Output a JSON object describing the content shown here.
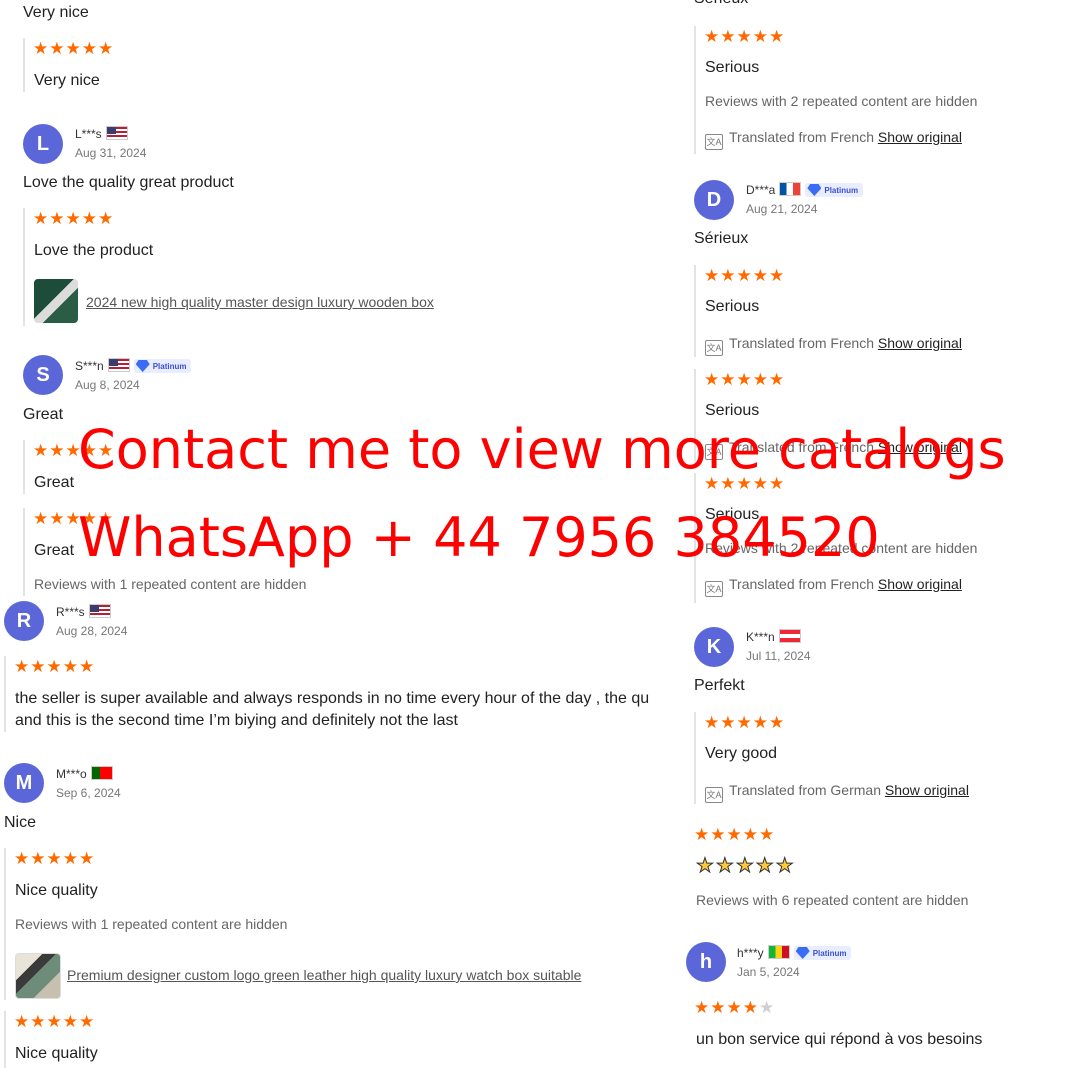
{
  "colors": {
    "star": "#ff6a00",
    "avatar": "#5b67d8",
    "overlay": "#ff0000"
  },
  "left": {
    "r0": {
      "title": "Very nice",
      "follow_text": "Very nice"
    },
    "r1": {
      "avatar": "L",
      "name": "L***s",
      "flag": "us",
      "date": "Aug 31, 2024",
      "title": "Love the quality great product",
      "follow_text": "Love the product",
      "product": "2024 new high quality master design                luxury wooden box"
    },
    "r2": {
      "avatar": "S",
      "name": "S***n",
      "flag": "us",
      "badge": "Platinum",
      "date": "Aug 8, 2024",
      "title": "Great",
      "follow1": "Great",
      "follow2": "Great",
      "hidden": "Reviews with 1 repeated content are hidden"
    },
    "r3": {
      "avatar": "R",
      "name": "R***s",
      "flag": "us",
      "date": "Aug 28, 2024",
      "line1": "the seller is super available and always responds in no time every hour of the day , the qu",
      "line2": "and this is the second time I’m biying and definitely not the last"
    },
    "r4": {
      "avatar": "M",
      "name": "M***o",
      "flag": "pt",
      "date": "Sep 6, 2024",
      "title": "Nice",
      "follow_text": "Nice quality",
      "hidden": "Reviews with 1 repeated content are hidden",
      "product": "Premium designer custom logo green leather high quality luxury watch box suitable",
      "follow2": "Nice quality"
    }
  },
  "right": {
    "top_title": "Sérieux",
    "r0": {
      "follow_text": "Serious",
      "hidden": "Reviews with 2 repeated content are hidden",
      "translated": "Translated from French",
      "show_original": "Show original"
    },
    "r1": {
      "avatar": "D",
      "name": "D***a",
      "flag": "fr",
      "badge": "Platinum",
      "date": "Aug 21, 2024",
      "title": "Sérieux",
      "f1": "Serious",
      "f1_trans": "Translated from French",
      "f1_show": "Show original",
      "f2": "Serious",
      "f2_trans": "Translated from French",
      "f2_show": "Show original",
      "f3": "Serious",
      "f3_hidden": "Reviews with 2 repeated content are hidden",
      "f3_trans": "Translated from French",
      "f3_show": "Show original"
    },
    "r2": {
      "avatar": "K",
      "name": "K***n",
      "flag": "at",
      "date": "Jul 11, 2024",
      "title": "Perfekt",
      "follow_text": "Very good",
      "translated": "Translated from German",
      "show_original": "Show original",
      "emoji_rating": 5,
      "hidden": "Reviews with 6 repeated content are hidden"
    },
    "r3": {
      "avatar": "h",
      "name": "h***y",
      "flag": "ml",
      "badge": "Platinum",
      "date": "Jan 5, 2024",
      "rating": 4,
      "text": "un bon service qui répond à vos besoins"
    }
  },
  "ratings": {
    "full": 5
  },
  "overlay": {
    "line1": "Contact me to view more catalogs",
    "line2": "WhatsApp + 44 7956 384520"
  }
}
